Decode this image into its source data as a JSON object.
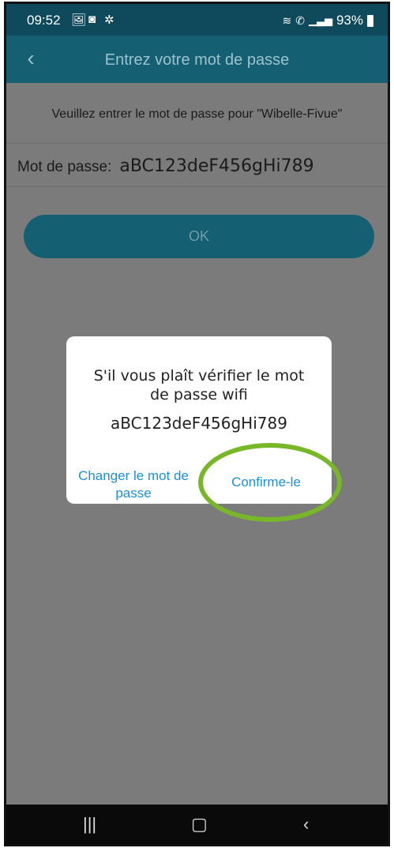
{
  "status_bar": {
    "time": "09:52",
    "battery": "93%",
    "icons": [
      "image-icon",
      "notification-icon",
      "settings-icon",
      "wifi-icon",
      "wifi-calling-icon",
      "signal-icon",
      "battery-icon"
    ]
  },
  "header": {
    "title": "Entrez votre mot de passe",
    "back_icon": "chevron-left-icon"
  },
  "main": {
    "prompt": "Veuillez entrer le mot de passe pour \"Wibelle-Fivue\"",
    "password_label": "Mot de passe:",
    "password_value": "aBC123deF456gHi789",
    "ok_label": "OK"
  },
  "dialog": {
    "message": "S'il vous plaît vérifier le mot de passe wifi",
    "password": "aBC123deF456gHi789",
    "change_label": "Changer le mot de passe",
    "confirm_label": "Confirme-le"
  },
  "navbar": {
    "recents_icon": "recents-icon",
    "home_icon": "home-icon",
    "back_icon": "back-icon"
  },
  "colors": {
    "status_bar": "#0f4a5c",
    "app_bar": "#155f72",
    "dialog_button": "#1a8fe0",
    "highlight": "#78b728"
  }
}
